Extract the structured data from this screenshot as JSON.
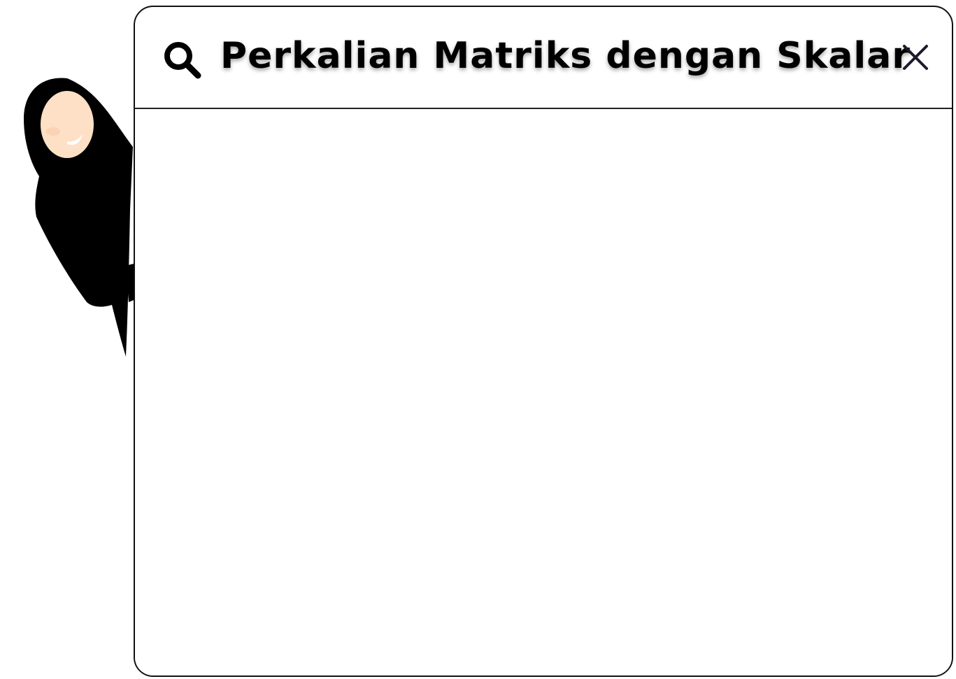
{
  "window": {
    "title": "Perkalian Matriks dengan Skalar",
    "search_icon": "search-icon",
    "close_icon": "close-icon"
  },
  "character": {
    "description_icon": "hijab-woman-presenter"
  },
  "colors": {
    "border": "#111111",
    "background": "#ffffff",
    "hijab": "#000000",
    "skin": "#fde0c5",
    "close_x": "#1c1b2e"
  }
}
